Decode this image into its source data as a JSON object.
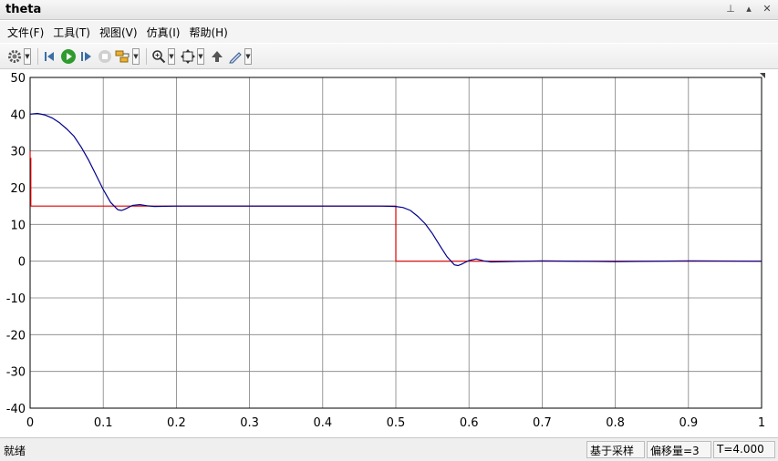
{
  "window": {
    "title": "theta"
  },
  "menu": [
    "文件(F)",
    "工具(T)",
    "视图(V)",
    "仿真(I)",
    "帮助(H)"
  ],
  "toolbar": {
    "buttons": [
      "gear-icon",
      "step-back-icon",
      "run-icon",
      "step-forward-icon",
      "stop-icon",
      "signal-select-icon",
      "zoom-icon",
      "fit-to-view-icon",
      "save-icon",
      "edit-style-icon"
    ]
  },
  "status": {
    "left": "就绪",
    "mode": "基于采样",
    "offset": "偏移量=3",
    "time": "T=4.000"
  },
  "colors": {
    "reference": "#e00000",
    "response": "#00008b",
    "grid": "#808080"
  },
  "chart_data": {
    "type": "line",
    "title": "",
    "xlabel": "",
    "ylabel": "",
    "xlim": [
      0,
      1
    ],
    "ylim": [
      -40,
      50
    ],
    "xticks": [
      "0",
      "0.1",
      "0.2",
      "0.3",
      "0.4",
      "0.5",
      "0.6",
      "0.7",
      "0.8",
      "0.9",
      "1"
    ],
    "yticks": [
      "50",
      "40",
      "30",
      "20",
      "10",
      "0",
      "-10",
      "-20",
      "-30",
      "-40"
    ],
    "grid": true,
    "series": [
      {
        "color": "#e00000",
        "x": [
          0,
          0,
          0.001,
          0.001,
          0.5,
          0.5,
          1.0
        ],
        "y": [
          30,
          28,
          28,
          15,
          15,
          0,
          0
        ]
      },
      {
        "color": "#00008b",
        "x": [
          0,
          0.01,
          0.02,
          0.03,
          0.04,
          0.05,
          0.06,
          0.07,
          0.08,
          0.09,
          0.1,
          0.11,
          0.12,
          0.125,
          0.13,
          0.14,
          0.15,
          0.16,
          0.17,
          0.2,
          0.3,
          0.4,
          0.48,
          0.5,
          0.51,
          0.52,
          0.53,
          0.54,
          0.55,
          0.56,
          0.57,
          0.58,
          0.585,
          0.59,
          0.6,
          0.61,
          0.62,
          0.63,
          0.7,
          0.8,
          0.9,
          1.0
        ],
        "y": [
          40,
          40.2,
          39.8,
          39,
          37.7,
          36,
          34,
          31,
          27.5,
          23.5,
          19.5,
          16,
          14,
          13.8,
          14.2,
          15.2,
          15.4,
          15.1,
          14.9,
          15,
          15,
          15,
          15,
          14.9,
          14.6,
          13.8,
          12.2,
          10.2,
          7.5,
          4.3,
          1.2,
          -1.0,
          -1.2,
          -0.8,
          0.2,
          0.6,
          0.1,
          -0.2,
          0.1,
          -0.1,
          0.1,
          0
        ]
      }
    ]
  }
}
